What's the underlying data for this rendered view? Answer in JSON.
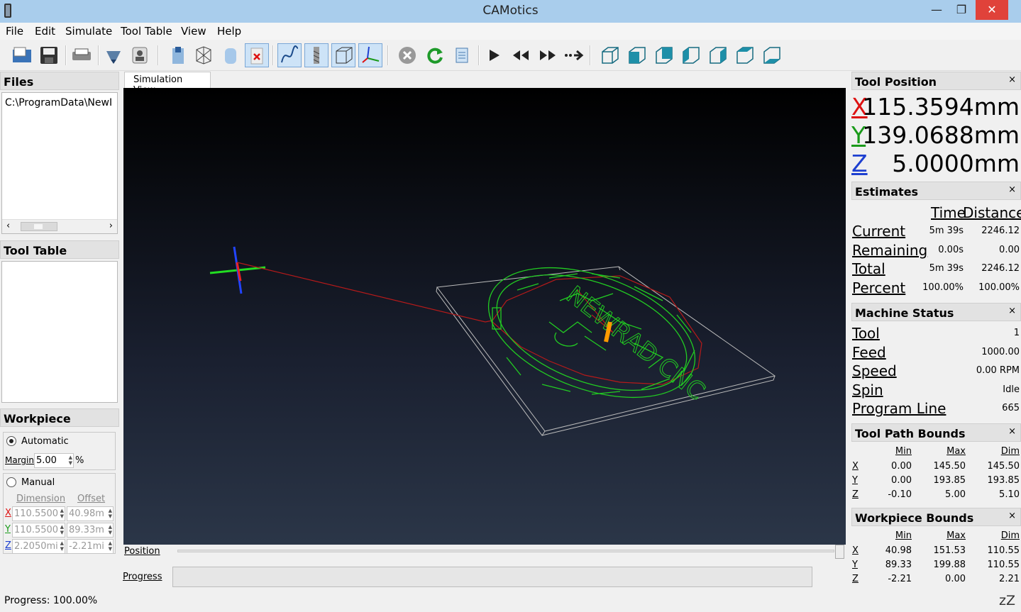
{
  "window": {
    "title": "CAMotics",
    "minimize": "—",
    "maximize": "❐",
    "close": "✕"
  },
  "menu": [
    "File",
    "Edit",
    "Simulate",
    "Tool Table",
    "View",
    "Help"
  ],
  "toolbar_icons": [
    "open-icon",
    "save-icon",
    "export-icon",
    "cut-icon",
    "properties-icon",
    "tool-view-icon",
    "wireframe-icon",
    "surface-icon",
    "hide-icon",
    "path-icon",
    "tool-icon",
    "box-icon",
    "axes-icon",
    "stop-icon",
    "rerun-icon",
    "reduce-icon",
    "play-icon",
    "slower-icon",
    "faster-icon",
    "step-icon",
    "iso-view-icon",
    "front-view-icon",
    "back-view-icon",
    "left-view-icon",
    "right-view-icon",
    "top-view-icon",
    "bottom-view-icon"
  ],
  "files": {
    "title": "Files",
    "path": "C:\\ProgramData\\NewI"
  },
  "tool_table": {
    "title": "Tool Table"
  },
  "workpiece": {
    "title": "Workpiece",
    "automatic_label": "Automatic",
    "margin_label": "Margin",
    "margin_value": "5.00",
    "percent": "%",
    "manual_label": "Manual",
    "dimension_header": "Dimension",
    "offset_header": "Offset",
    "rows": [
      {
        "axis": "X",
        "dim": "110.5500",
        "off": "40.98m"
      },
      {
        "axis": "Y",
        "dim": "110.5500",
        "off": "89.33m"
      },
      {
        "axis": "Z",
        "dim": "2.2050mi",
        "off": "-2.21mi"
      }
    ]
  },
  "center": {
    "tab": "Simulation View",
    "position_label": "Position",
    "progress_label": "Progress",
    "model_text": "NEWRAD CNC"
  },
  "tool_position": {
    "title": "Tool Position",
    "x_label": "X",
    "x": "115.3594mm",
    "y_label": "Y",
    "y": "139.0688mm",
    "z_label": "Z",
    "z": "5.0000mm"
  },
  "estimates": {
    "title": "Estimates",
    "time_header": "Time",
    "distance_header": "Distance",
    "rows": [
      {
        "label": "Current",
        "time": "5m 39s",
        "dist": "2246.12"
      },
      {
        "label": "Remaining",
        "time": "0.00s",
        "dist": "0.00"
      },
      {
        "label": "Total",
        "time": "5m 39s",
        "dist": "2246.12"
      },
      {
        "label": "Percent",
        "time": "100.00%",
        "dist": "100.00%"
      }
    ]
  },
  "machine_status": {
    "title": "Machine Status",
    "rows": [
      {
        "label": "Tool",
        "value": "1"
      },
      {
        "label": "Feed",
        "value": "1000.00"
      },
      {
        "label": "Speed",
        "value": "0.00 RPM"
      },
      {
        "label": "Spin",
        "value": "Idle"
      },
      {
        "label": "Program Line",
        "value": "665"
      }
    ]
  },
  "tool_path_bounds": {
    "title": "Tool Path Bounds",
    "headers": [
      "Min",
      "Max",
      "Dim"
    ],
    "rows": [
      {
        "axis": "X",
        "min": "0.00",
        "max": "145.50",
        "dim": "145.50"
      },
      {
        "axis": "Y",
        "min": "0.00",
        "max": "193.85",
        "dim": "193.85"
      },
      {
        "axis": "Z",
        "min": "-0.10",
        "max": "5.00",
        "dim": "5.10"
      }
    ]
  },
  "workpiece_bounds": {
    "title": "Workpiece Bounds",
    "headers": [
      "Min",
      "Max",
      "Dim"
    ],
    "rows": [
      {
        "axis": "X",
        "min": "40.98",
        "max": "151.53",
        "dim": "110.55"
      },
      {
        "axis": "Y",
        "min": "89.33",
        "max": "199.88",
        "dim": "110.55"
      },
      {
        "axis": "Z",
        "min": "-2.21",
        "max": "0.00",
        "dim": "2.21"
      }
    ]
  },
  "status": {
    "progress": "Progress: 100.00%",
    "sleep": "zZ"
  },
  "dock_close": "×"
}
